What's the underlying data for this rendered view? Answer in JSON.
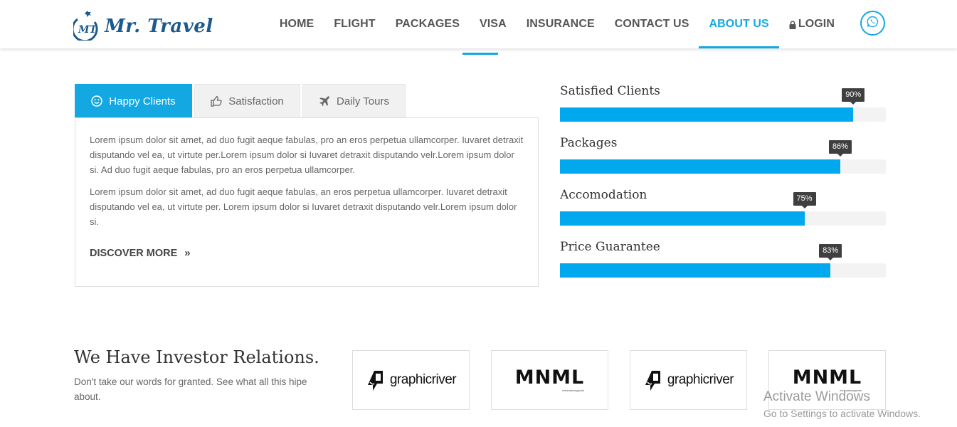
{
  "brand": {
    "name": "Mr. Travel",
    "monogram": "MT",
    "color": "#1c5a8e"
  },
  "nav": {
    "items": [
      {
        "label": "HOME"
      },
      {
        "label": "FLIGHT"
      },
      {
        "label": "PACKAGES"
      },
      {
        "label": "VISA"
      },
      {
        "label": "INSURANCE"
      },
      {
        "label": "CONTACT US"
      },
      {
        "label": "ABOUT US",
        "active": true
      },
      {
        "label": "LOGIN",
        "icon": "lock-icon"
      }
    ],
    "contact_icon": "whatsapp-icon",
    "accent_color": "#14a8e3"
  },
  "tabs": {
    "items": [
      {
        "label": "Happy Clients",
        "icon": "smile-icon",
        "active": true
      },
      {
        "label": "Satisfaction",
        "icon": "thumbs-up-icon"
      },
      {
        "label": "Daily Tours",
        "icon": "plane-icon"
      }
    ],
    "panel": {
      "paragraphs": [
        "Lorem ipsum dolor sit amet, ad duo fugit aeque fabulas, pro an eros perpetua ullamcorper. Iuvaret detraxit disputando vel ea, ut virtute per.Lorem ipsum dolor si Iuvaret detraxit disputando velr.Lorem ipsum dolor si. Ad duo fugit aeque fabulas, pro an eros perpetua ullamcorper.",
        "Lorem ipsum dolor sit amet, ad duo fugit aeque fabulas, an eros perpetua ullamcorper. Iuvaret detraxit disputando vel ea, ut virtute per. Lorem ipsum dolor si Iuvaret detraxit disputando velr.Lorem ipsum dolor si."
      ],
      "cta": "DISCOVER MORE",
      "cta_icon": "double-chevron-right-icon"
    }
  },
  "skills": [
    {
      "label": "Satisfied Clients",
      "percent": 90,
      "display": "90%"
    },
    {
      "label": "Packages",
      "percent": 86,
      "display": "86%"
    },
    {
      "label": "Accomodation",
      "percent": 75,
      "display": "75%"
    },
    {
      "label": "Price Guarantee",
      "percent": 83,
      "display": "83%"
    }
  ],
  "investors": {
    "title": "We Have Investor Relations.",
    "subtitle": "Don't take our words for granted. See what all this hipe about.",
    "partners": [
      {
        "name": "graphicriver",
        "logo": "graphicriver-logo"
      },
      {
        "name": "MNML",
        "tagline": "minimalmagazine",
        "logo": "mnml-logo"
      },
      {
        "name": "graphicriver",
        "logo": "graphicriver-logo"
      },
      {
        "name": "MNML",
        "tagline": "minimalmagazine",
        "logo": "mnml-logo"
      }
    ]
  },
  "watermark": {
    "title": "Activate Windows",
    "subtitle": "Go to Settings to activate Windows."
  }
}
